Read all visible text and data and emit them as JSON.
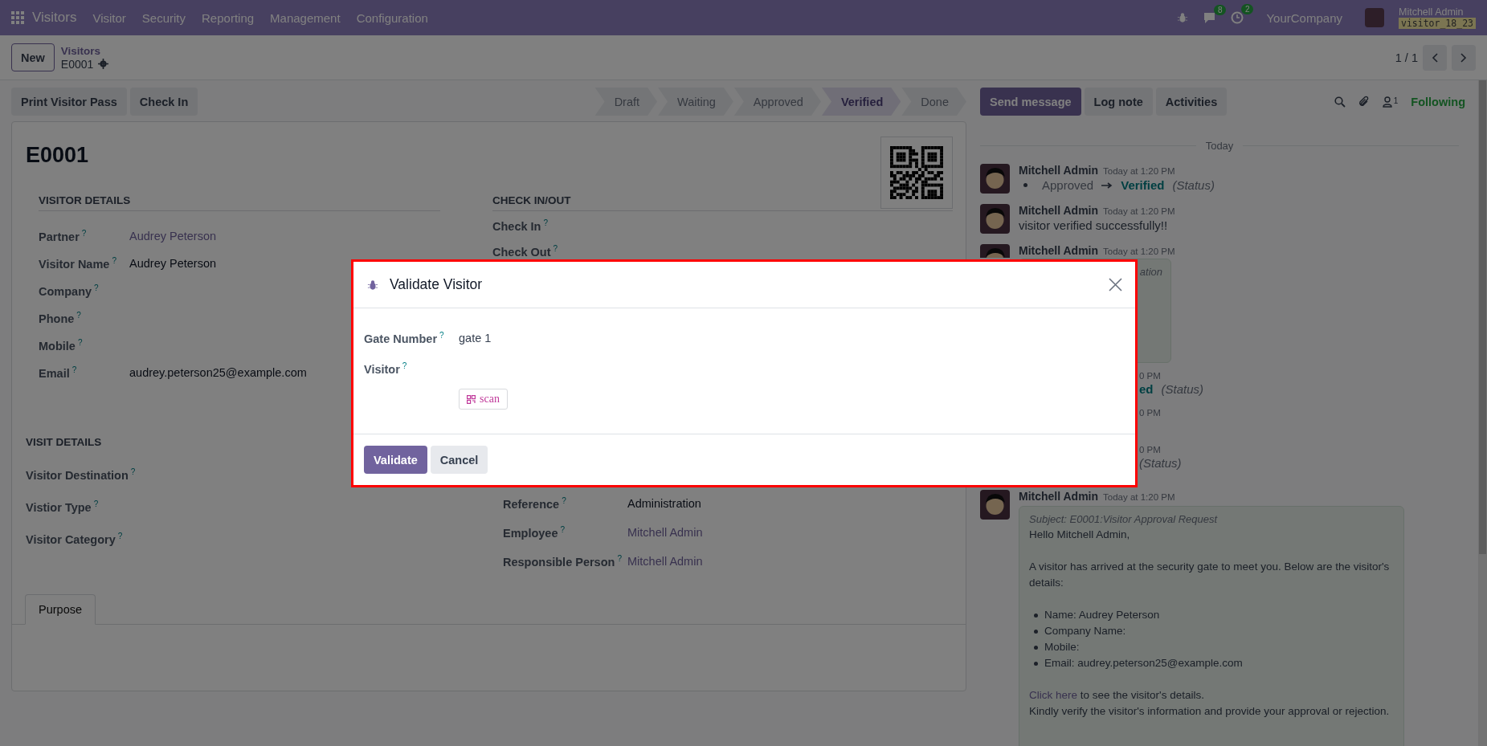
{
  "navbar": {
    "app": "Visitors",
    "menus": [
      "Visitor",
      "Security",
      "Reporting",
      "Management",
      "Configuration"
    ],
    "messages_count": "8",
    "activities_count": "2",
    "company": "YourCompany",
    "user": "Mitchell Admin",
    "database": "visitor_18_23"
  },
  "control_panel": {
    "new_button": "New",
    "breadcrumb": "Visitors",
    "record": "E0001",
    "pager": "1 / 1"
  },
  "actions": [
    "Print Visitor Pass",
    "Check In"
  ],
  "statusbar": [
    {
      "label": "Draft",
      "selected": false
    },
    {
      "label": "Waiting",
      "selected": false
    },
    {
      "label": "Approved",
      "selected": false
    },
    {
      "label": "Verified",
      "selected": true
    },
    {
      "label": "Done",
      "selected": false
    }
  ],
  "chatter_buttons": [
    {
      "label": "Send message",
      "primary": true
    },
    {
      "label": "Log note",
      "primary": false
    },
    {
      "label": "Activities",
      "primary": false
    }
  ],
  "followers": {
    "count": "1",
    "label": "Following"
  },
  "form": {
    "title": "E0001",
    "visitor_details": {
      "heading": "VISITOR DETAILS",
      "fields": [
        {
          "label": "Partner",
          "help": "?",
          "value": "Audrey Peterson",
          "link": true
        },
        {
          "label": "Visitor Name",
          "help": "?",
          "value": "Audrey Peterson",
          "link": false
        },
        {
          "label": "Company",
          "help": "?"
        },
        {
          "label": "Phone",
          "help": "?"
        },
        {
          "label": "Mobile",
          "help": "?"
        },
        {
          "label": "Email",
          "help": "?",
          "value": "audrey.peterson25@example.com",
          "link": false
        }
      ]
    },
    "check_in_out": {
      "heading": "CHECK IN/OUT",
      "fields": [
        {
          "label": "Check In",
          "help": "?"
        },
        {
          "label": "Check Out",
          "help": "?"
        }
      ]
    },
    "visit_details": {
      "heading": "VISIT DETAILS",
      "left": [
        {
          "label": "Visitor Destination",
          "help": "?"
        },
        {
          "label": "Vistior Type",
          "help": "?"
        },
        {
          "label": "Visitor Category",
          "help": "?"
        }
      ],
      "right": [
        {
          "label": "Reference",
          "help": "?",
          "value": "Administration",
          "link": false
        },
        {
          "label": "Employee",
          "help": "?",
          "value": "Mitchell Admin",
          "link": true
        },
        {
          "label": "Responsible Person",
          "help": "?",
          "value": "Mitchell Admin",
          "link": true
        }
      ]
    },
    "tabs": [
      {
        "label": "Purpose",
        "selected": true
      }
    ]
  },
  "dialog": {
    "title": "Validate Visitor",
    "fields": [
      {
        "label": "Gate Number",
        "help": "?",
        "value": "gate 1"
      },
      {
        "label": "Visitor",
        "help": "?"
      }
    ],
    "scan_button": "scan",
    "buttons": [
      {
        "label": "Validate",
        "primary": true
      },
      {
        "label": "Cancel",
        "primary": false
      }
    ]
  },
  "chatter": {
    "date_separator": "Today",
    "messages": [
      {
        "kind": "tracking",
        "author": "Mitchell Admin",
        "time": "Today at 1:20 PM",
        "old": "Approved",
        "new": "Verified",
        "field": "(Status)"
      },
      {
        "kind": "note",
        "author": "Mitchell Admin",
        "time": "Today at 1:20 PM",
        "body": "visitor verified successfully!!"
      },
      {
        "kind": "card",
        "author": "Mitchell Admin",
        "time": "Today at 1:20 PM",
        "text": "ation"
      },
      {
        "kind": "fragment",
        "time": "0 PM",
        "new": "ed",
        "field": "(Status)"
      },
      {
        "kind": "fragment",
        "time": "0 PM"
      },
      {
        "kind": "fragment",
        "time": "0 PM",
        "field": "(Status)"
      },
      {
        "kind": "email",
        "author": "Mitchell Admin",
        "time": "Today at 1:20 PM",
        "subject": "Subject: E0001:Visitor Approval Request",
        "greeting": "Hello Mitchell Admin,",
        "intro": "A visitor has arrived at the security gate to meet you. Below are the visitor's details:",
        "items": [
          "Name: Audrey Peterson",
          "Company Name:",
          "Mobile:",
          "Email: audrey.peterson25@example.com"
        ],
        "link": "Click here",
        "link_rest": "to see the visitor's details.",
        "closing": "Kindly verify the visitor's information and provide your approval or rejection."
      }
    ]
  }
}
